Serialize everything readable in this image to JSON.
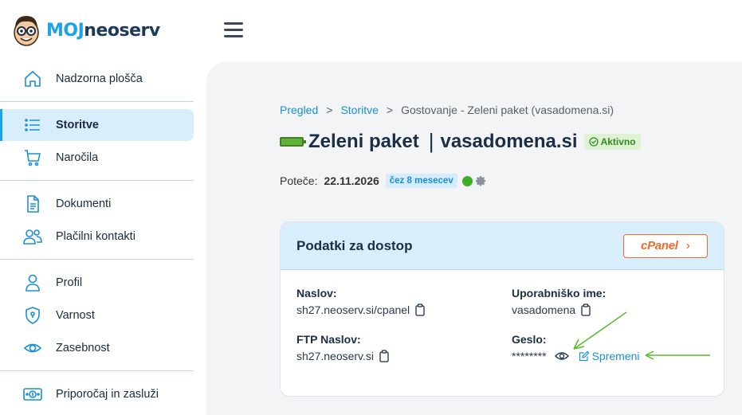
{
  "logo": {
    "brand_prefix": "MOJ",
    "brand_suffix": "neoserv"
  },
  "sidebar": {
    "items": [
      {
        "label": "Nadzorna plošča",
        "icon": "home-icon"
      },
      {
        "label": "Storitve",
        "icon": "list-icon",
        "active": true
      },
      {
        "label": "Naročila",
        "icon": "cart-icon"
      },
      {
        "label": "Dokumenti",
        "icon": "document-icon"
      },
      {
        "label": "Plačilni kontakti",
        "icon": "users-icon"
      },
      {
        "label": "Profil",
        "icon": "user-icon"
      },
      {
        "label": "Varnost",
        "icon": "shield-icon"
      },
      {
        "label": "Zasebnost",
        "icon": "eye-icon"
      },
      {
        "label": "Priporočaj in zasluži",
        "icon": "money-icon"
      }
    ]
  },
  "breadcrumb": {
    "items": [
      "Pregled",
      "Storitve",
      "Gostovanje - Zeleni paket (vasadomena.si)"
    ],
    "separator": ">"
  },
  "service": {
    "package_name": "Zeleni paket",
    "separator": "|",
    "domain": "vasadomena.si",
    "status": "Aktivno",
    "expiry_label": "Poteče:",
    "expiry_date": "22.11.2026",
    "expiry_relative": "čez 8 mesecev"
  },
  "access_card": {
    "title": "Podatki za dostop",
    "cpanel_label": "cPanel",
    "address_label": "Naslov:",
    "address_value": "sh27.neoserv.si/cpanel",
    "username_label": "Uporabniško ime:",
    "username_value": "vasadomena",
    "ftp_label": "FTP Naslov:",
    "ftp_value": "sh27.neoserv.si",
    "password_label": "Geslo:",
    "password_value": "********",
    "change_label": "Spremeni"
  },
  "colors": {
    "accent": "#1aa3e8",
    "active_bg": "#d9eefb",
    "status_green": "#3cb02a",
    "cpanel_orange": "#ef6a2d",
    "annotation_arrow": "#5cb82a"
  }
}
